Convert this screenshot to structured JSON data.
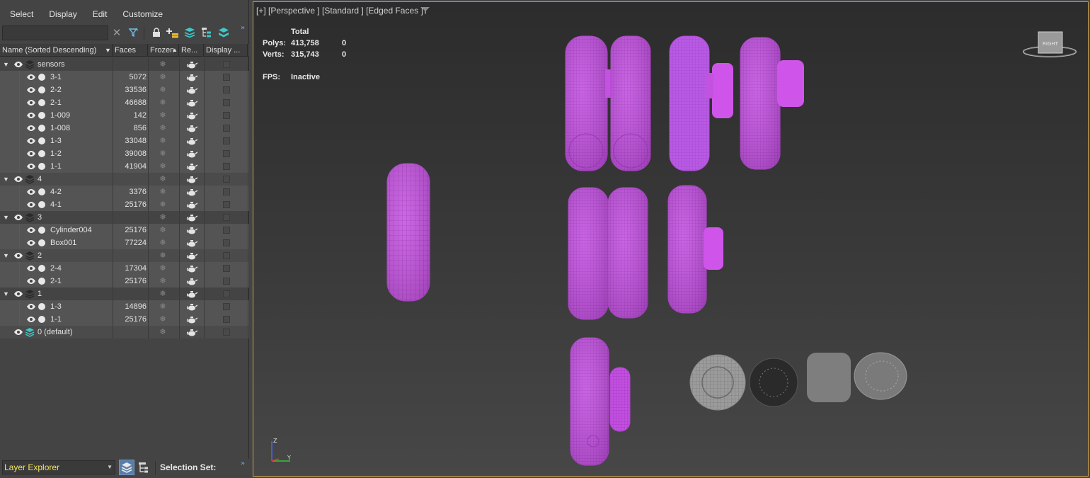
{
  "menu": [
    "Select",
    "Display",
    "Edit",
    "Customize"
  ],
  "search": {
    "value": "",
    "placeholder": ""
  },
  "columns": {
    "name": "Name (Sorted Descending)",
    "faces": "Faces",
    "frozen": "Frozen",
    "render": "Re...",
    "display": "Display ..."
  },
  "tree": [
    {
      "type": "layer",
      "name": "sensors",
      "faces": ""
    },
    {
      "type": "object",
      "name": "3-1",
      "faces": "5072"
    },
    {
      "type": "object",
      "name": "2-2",
      "faces": "33536"
    },
    {
      "type": "object",
      "name": "2-1",
      "faces": "46688"
    },
    {
      "type": "object",
      "name": "1-009",
      "faces": "142"
    },
    {
      "type": "object",
      "name": "1-008",
      "faces": "856"
    },
    {
      "type": "object",
      "name": "1-3",
      "faces": "33048"
    },
    {
      "type": "object",
      "name": "1-2",
      "faces": "39008"
    },
    {
      "type": "object",
      "name": "1-1",
      "faces": "41904"
    },
    {
      "type": "layer",
      "name": "4",
      "faces": ""
    },
    {
      "type": "object",
      "name": "4-2",
      "faces": "3376"
    },
    {
      "type": "object",
      "name": "4-1",
      "faces": "25176"
    },
    {
      "type": "layer",
      "name": "3",
      "faces": ""
    },
    {
      "type": "object",
      "name": "Cylinder004",
      "faces": "25176"
    },
    {
      "type": "object",
      "name": "Box001",
      "faces": "77224"
    },
    {
      "type": "layer",
      "name": "2",
      "faces": ""
    },
    {
      "type": "object",
      "name": "2-4",
      "faces": "17304"
    },
    {
      "type": "object",
      "name": "2-1",
      "faces": "25176"
    },
    {
      "type": "layer",
      "name": "1",
      "faces": ""
    },
    {
      "type": "object",
      "name": "1-3",
      "faces": "14896"
    },
    {
      "type": "object",
      "name": "1-1",
      "faces": "25176"
    },
    {
      "type": "default",
      "name": "0 (default)",
      "faces": ""
    }
  ],
  "bottom": {
    "explorer": "Layer Explorer",
    "selection_set_label": "Selection Set:"
  },
  "viewport": {
    "label": "[+] [Perspective ] [Standard ] [Edged Faces ]",
    "stats": {
      "header": "Total",
      "polys_label": "Polys:",
      "polys_total": "413,758",
      "polys_sel": "0",
      "verts_label": "Verts:",
      "verts_total": "315,743",
      "verts_sel": "0",
      "fps_label": "FPS:",
      "fps_value": "Inactive"
    },
    "viewcube_label": "RIGHT",
    "axis_labels": {
      "z": "Z",
      "y": "Y"
    }
  },
  "colors": {
    "wire_magenta": "#cc55e6",
    "viewport_border": "#c9a34a",
    "explorer_text": "#f1e35b",
    "selected_button": "#5a7da8"
  }
}
